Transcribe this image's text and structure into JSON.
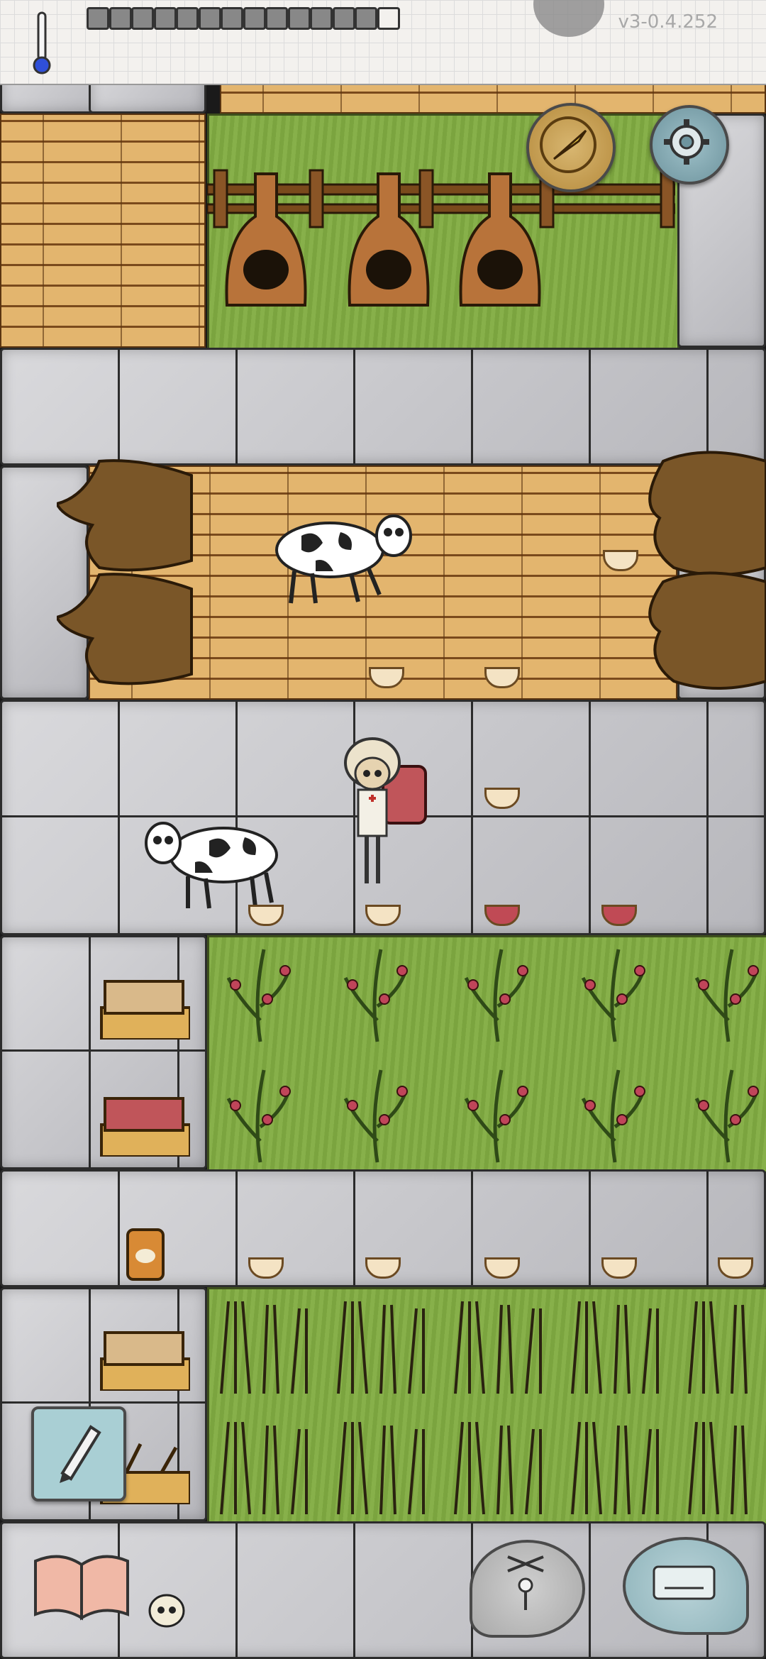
{
  "version": "v3-0.4.252",
  "hud": {
    "temperature_icon": "thermometer-icon",
    "hint_arrow": "compass-arrow-icon",
    "settings_icon": "gear-icon",
    "note_icon": "pencil-icon",
    "book_icon": "book-icon",
    "emote_icon": "puppet-icon",
    "chat_icon": "keyboard-icon"
  },
  "colors": {
    "stone": "#c8c8cc",
    "wood": "#e3b56e",
    "grass": "#7da63c",
    "berry": "#c04a55",
    "hint_button": "#c8a45a",
    "settings_button": "#7fa3ad"
  },
  "inventory_slots": 14
}
